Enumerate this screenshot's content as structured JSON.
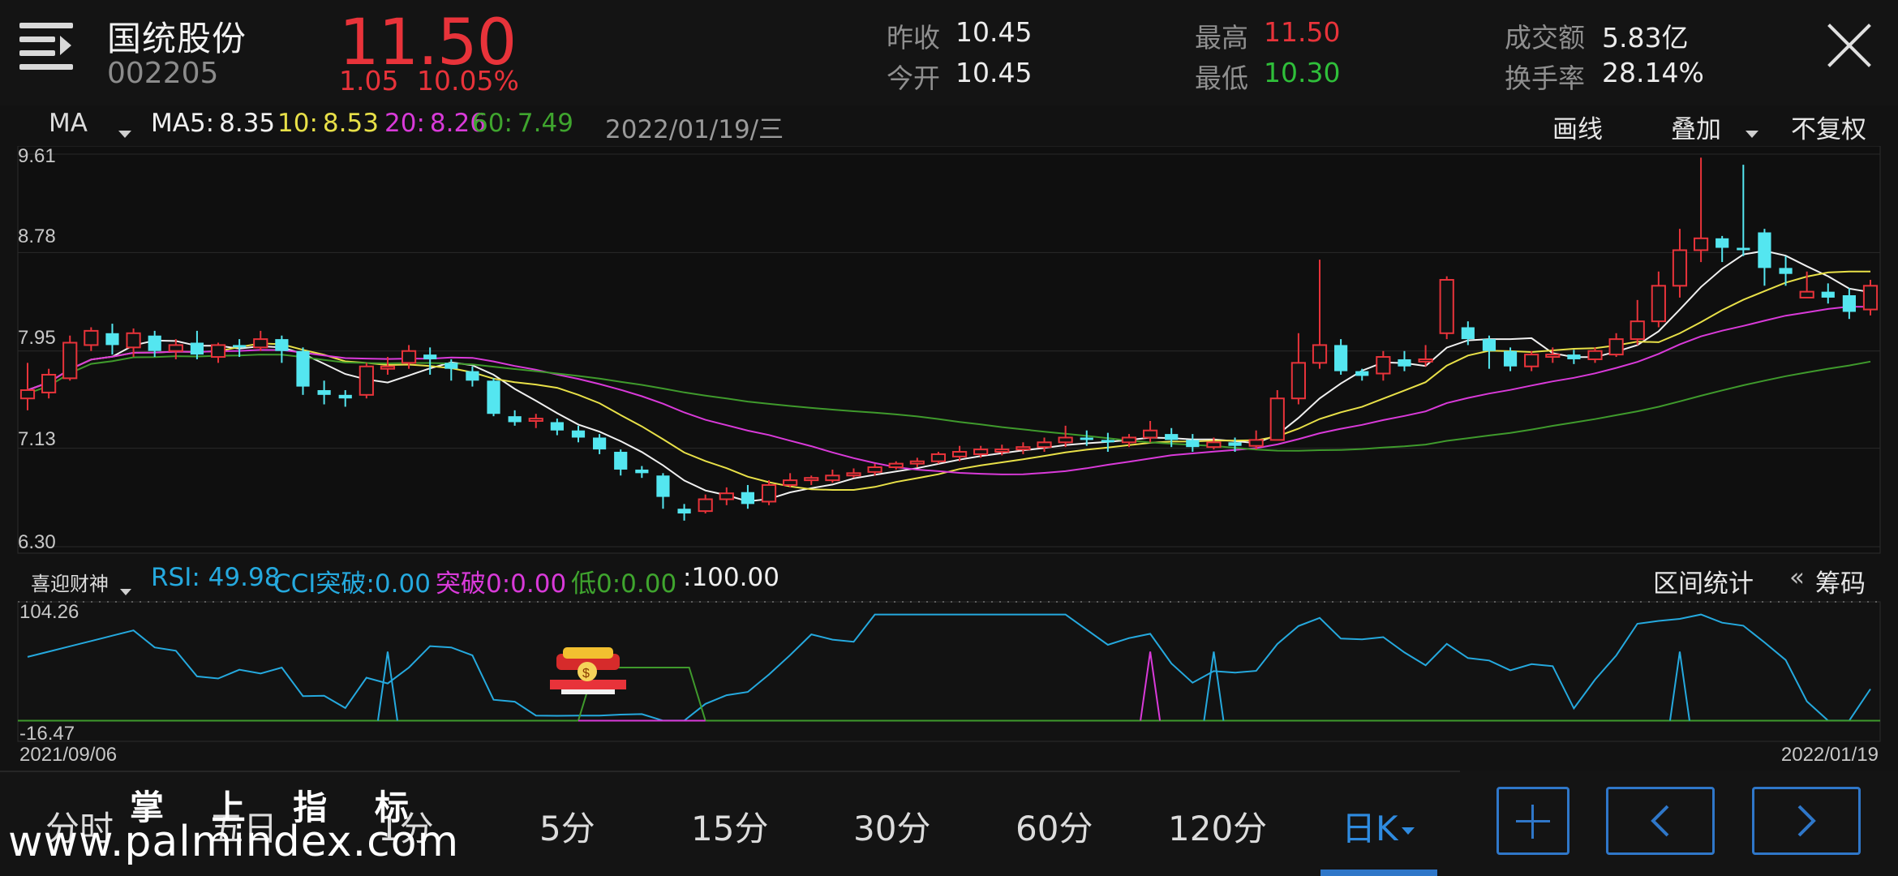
{
  "stock": {
    "name": "国统股份",
    "code": "002205",
    "price": "11.50",
    "change": "1.05",
    "change_pct": "10.05%"
  },
  "quote": {
    "prev_close_label": "昨收",
    "prev_close": "10.45",
    "open_label": "今开",
    "open": "10.45",
    "high_label": "最高",
    "high": "11.50",
    "low_label": "最低",
    "low": "10.30",
    "turnover_label": "成交额",
    "turnover": "5.83亿",
    "turnover_rate_label": "换手率",
    "turnover_rate": "28.14%"
  },
  "ma_bar": {
    "indicator": "MA",
    "ma5_label": "MA5:",
    "ma5": "8.35",
    "ma10_label": "10:",
    "ma10": "8.53",
    "ma20_label": "20:",
    "ma20": "8.26",
    "ma60_label": "60:",
    "ma60": "7.49",
    "date": "2022/01/19/三",
    "draw_label": "画线",
    "overlay_label": "叠加",
    "adjust_label": "不复权"
  },
  "sub_bar": {
    "indicator": "喜迎财神",
    "rsi_label": "RSI:",
    "rsi": "49.98",
    "cci_label": "CCI突破:",
    "cci": "0.00",
    "break_label": "突破0:",
    "break": "0.00",
    "low_label": "低0:",
    "low": "0.00",
    "extra": ":100.00",
    "range_stats": "区间统计",
    "chips": "筹码",
    "chips_icon": "double-chevron-left-icon"
  },
  "dates": {
    "start": "2021/09/06",
    "end": "2022/01/19"
  },
  "tabs": [
    "分时",
    "五日",
    "1分",
    "5分",
    "15分",
    "30分",
    "60分",
    "120分",
    "日K"
  ],
  "active_tab": "日K",
  "watermark": {
    "title": "掌 上 指 标",
    "url": "www.palmindex.com"
  },
  "colors": {
    "up": "#e8333a",
    "down": "#54e6f0",
    "ma5": "#f0f0f0",
    "ma10": "#e8e048",
    "ma20": "#d93ad9",
    "ma60": "#3f9a2c",
    "rsi": "#25a9de",
    "accent": "#2f77c9"
  },
  "chart_data": [
    {
      "type": "candlestick",
      "y_ticks": [
        "9.61",
        "8.78",
        "7.95",
        "7.13",
        "6.30"
      ],
      "ylim": [
        6.3,
        9.61
      ],
      "x_range": [
        "2021/09/06",
        "2022/01/19"
      ],
      "series": [
        {
          "name": "MA5",
          "value": 8.35
        },
        {
          "name": "10",
          "value": 8.53
        },
        {
          "name": "20",
          "value": 8.26
        },
        {
          "name": "60",
          "value": 7.49
        }
      ],
      "candles": [
        [
          7.55,
          7.62,
          7.85,
          7.45
        ],
        [
          7.6,
          7.75,
          7.8,
          7.55
        ],
        [
          7.72,
          8.02,
          8.08,
          7.7
        ],
        [
          8.0,
          8.12,
          8.15,
          7.95
        ],
        [
          8.1,
          8.0,
          8.18,
          7.92
        ],
        [
          7.98,
          8.1,
          8.14,
          7.9
        ],
        [
          8.08,
          7.95,
          8.12,
          7.9
        ],
        [
          7.95,
          8.0,
          8.05,
          7.88
        ],
        [
          8.02,
          7.92,
          8.12,
          7.88
        ],
        [
          7.9,
          8.0,
          8.02,
          7.85
        ],
        [
          8.0,
          7.98,
          8.05,
          7.9
        ],
        [
          7.98,
          8.05,
          8.12,
          7.95
        ],
        [
          8.05,
          7.95,
          8.08,
          7.85
        ],
        [
          7.95,
          7.65,
          7.98,
          7.58
        ],
        [
          7.62,
          7.58,
          7.7,
          7.5
        ],
        [
          7.58,
          7.55,
          7.62,
          7.48
        ],
        [
          7.58,
          7.82,
          7.85,
          7.55
        ],
        [
          7.8,
          7.82,
          7.9,
          7.75
        ],
        [
          7.85,
          7.95,
          8.0,
          7.8
        ],
        [
          7.92,
          7.88,
          7.98,
          7.75
        ],
        [
          7.85,
          7.8,
          7.88,
          7.7
        ],
        [
          7.78,
          7.7,
          7.82,
          7.65
        ],
        [
          7.7,
          7.42,
          7.72,
          7.4
        ],
        [
          7.4,
          7.35,
          7.45,
          7.32
        ],
        [
          7.36,
          7.38,
          7.42,
          7.3
        ],
        [
          7.35,
          7.28,
          7.38,
          7.24
        ],
        [
          7.28,
          7.22,
          7.32,
          7.18
        ],
        [
          7.22,
          7.12,
          7.25,
          7.08
        ],
        [
          7.1,
          6.95,
          7.12,
          6.9
        ],
        [
          6.95,
          6.92,
          6.98,
          6.88
        ],
        [
          6.9,
          6.72,
          6.92,
          6.62
        ],
        [
          6.62,
          6.58,
          6.66,
          6.52
        ],
        [
          6.6,
          6.7,
          6.74,
          6.58
        ],
        [
          6.7,
          6.75,
          6.8,
          6.65
        ],
        [
          6.76,
          6.66,
          6.82,
          6.62
        ],
        [
          6.68,
          6.82,
          6.86,
          6.65
        ],
        [
          6.82,
          6.86,
          6.92,
          6.8
        ],
        [
          6.86,
          6.88,
          6.9,
          6.82
        ],
        [
          6.86,
          6.9,
          6.95,
          6.84
        ],
        [
          6.9,
          6.92,
          6.96,
          6.88
        ],
        [
          6.93,
          6.97,
          7.0,
          6.9
        ],
        [
          6.97,
          7.0,
          7.02,
          6.95
        ],
        [
          7.0,
          7.02,
          7.05,
          6.97
        ],
        [
          7.02,
          7.08,
          7.1,
          7.0
        ],
        [
          7.06,
          7.1,
          7.15,
          7.02
        ],
        [
          7.08,
          7.12,
          7.15,
          7.05
        ],
        [
          7.1,
          7.12,
          7.16,
          7.07
        ],
        [
          7.12,
          7.14,
          7.18,
          7.08
        ],
        [
          7.14,
          7.18,
          7.22,
          7.1
        ],
        [
          7.18,
          7.22,
          7.32,
          7.14
        ],
        [
          7.22,
          7.2,
          7.28,
          7.15
        ],
        [
          7.2,
          7.18,
          7.26,
          7.1
        ],
        [
          7.18,
          7.22,
          7.25,
          7.14
        ],
        [
          7.22,
          7.28,
          7.36,
          7.18
        ],
        [
          7.25,
          7.2,
          7.3,
          7.14
        ],
        [
          7.2,
          7.14,
          7.25,
          7.1
        ],
        [
          7.14,
          7.18,
          7.22,
          7.12
        ],
        [
          7.18,
          7.15,
          7.22,
          7.1
        ],
        [
          7.15,
          7.2,
          7.28,
          7.12
        ],
        [
          7.2,
          7.55,
          7.62,
          7.2
        ],
        [
          7.55,
          7.85,
          8.1,
          7.5
        ],
        [
          7.85,
          8.0,
          8.72,
          7.8
        ],
        [
          8.0,
          7.78,
          8.05,
          7.75
        ],
        [
          7.78,
          7.74,
          7.8,
          7.7
        ],
        [
          7.76,
          7.9,
          7.95,
          7.7
        ],
        [
          7.88,
          7.82,
          7.95,
          7.78
        ],
        [
          7.86,
          7.88,
          8.0,
          7.82
        ],
        [
          8.1,
          8.55,
          8.58,
          8.05
        ],
        [
          8.15,
          8.05,
          8.2,
          8.0
        ],
        [
          8.05,
          7.95,
          8.08,
          7.8
        ],
        [
          7.95,
          7.82,
          7.98,
          7.78
        ],
        [
          7.82,
          7.92,
          7.95,
          7.78
        ],
        [
          7.9,
          7.92,
          7.98,
          7.85
        ],
        [
          7.92,
          7.88,
          7.96,
          7.84
        ],
        [
          7.88,
          7.95,
          7.98,
          7.85
        ],
        [
          7.92,
          8.05,
          8.1,
          7.9
        ],
        [
          8.05,
          8.2,
          8.38,
          8.0
        ],
        [
          8.2,
          8.5,
          8.62,
          8.15
        ],
        [
          8.5,
          8.8,
          8.98,
          8.4
        ],
        [
          8.8,
          8.9,
          9.58,
          8.7
        ],
        [
          8.9,
          8.82,
          8.92,
          8.7
        ],
        [
          8.82,
          8.8,
          9.52,
          8.75
        ],
        [
          8.95,
          8.65,
          8.98,
          8.5
        ],
        [
          8.65,
          8.6,
          8.75,
          8.5
        ],
        [
          8.4,
          8.45,
          8.62,
          8.4
        ],
        [
          8.45,
          8.4,
          8.52,
          8.35
        ],
        [
          8.42,
          8.28,
          8.48,
          8.22
        ],
        [
          8.3,
          8.5,
          8.55,
          8.25
        ]
      ]
    },
    {
      "type": "line",
      "y_ticks": [
        "104.26",
        "-16.47"
      ],
      "ylim": [
        -16.47,
        104.26
      ],
      "x_range": [
        "2021/09/06",
        "2022/01/19"
      ],
      "series": [
        {
          "name": "RSI",
          "last": 49.98
        },
        {
          "name": "CCI突破",
          "last": 0.0
        },
        {
          "name": "突破0",
          "last": 0.0
        },
        {
          "name": "低0",
          "last": 0.0
        }
      ]
    }
  ]
}
